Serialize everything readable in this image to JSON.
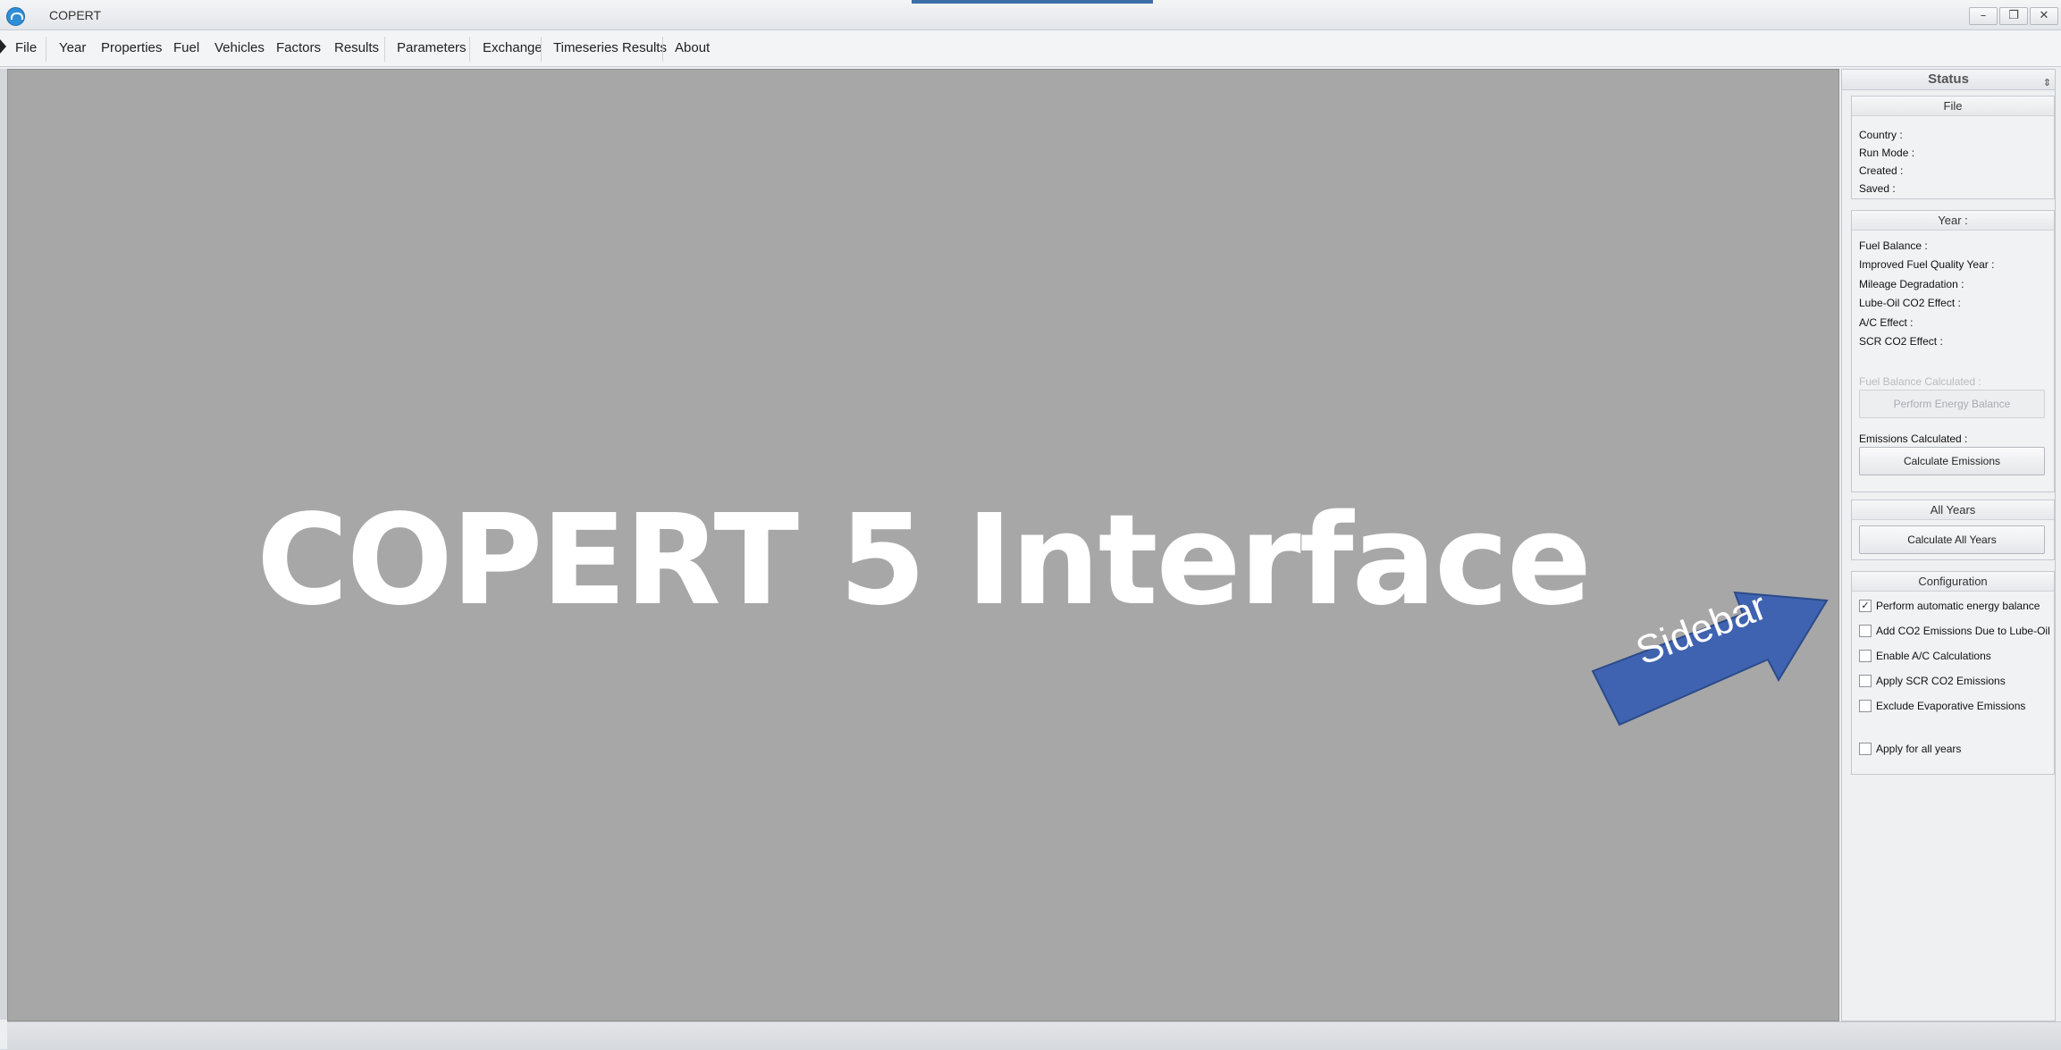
{
  "window": {
    "title": "COPERT",
    "controls": {
      "minimize": "–",
      "restore": "❐",
      "close": "✕"
    }
  },
  "menu": {
    "items": [
      {
        "label": "File"
      },
      {
        "label": "Year"
      },
      {
        "label": "Properties"
      },
      {
        "label": "Fuel"
      },
      {
        "label": "Vehicles"
      },
      {
        "label": "Factors"
      },
      {
        "label": "Results"
      },
      {
        "label": "Parameters"
      },
      {
        "label": "Exchange"
      },
      {
        "label": "Timeseries Results"
      },
      {
        "label": "About"
      }
    ]
  },
  "main": {
    "heading": "COPERT 5 Interface",
    "callout": "Sidebar"
  },
  "sidebar": {
    "title": "Status",
    "pin_icon": "pin-icon",
    "file": {
      "title": "File",
      "country": "Country :",
      "run_mode": "Run Mode :",
      "created": "Created :",
      "saved": "Saved :"
    },
    "year": {
      "title": "Year :",
      "fuel_balance": "Fuel Balance :",
      "improved_fuel_quality_year": "Improved Fuel Quality Year :",
      "mileage_degradation": "Mileage Degradation :",
      "lube_oil_co2_effect": "Lube-Oil CO2 Effect :",
      "ac_effect": "A/C Effect :",
      "scr_co2_effect": "SCR CO2 Effect :",
      "fuel_balance_calculated": "Fuel Balance Calculated :",
      "perform_energy_balance": "Perform Energy Balance",
      "emissions_calculated": "Emissions Calculated :",
      "calculate_emissions": "Calculate Emissions"
    },
    "all_years": {
      "title": "All Years",
      "calculate_all_years": "Calculate All Years"
    },
    "configuration": {
      "title": "Configuration",
      "options": [
        {
          "label": "Perform automatic energy balance",
          "checked": true,
          "mark": "✓"
        },
        {
          "label": "Add CO2 Emissions Due to Lube-Oil",
          "checked": false,
          "mark": ""
        },
        {
          "label": "Enable A/C Calculations",
          "checked": false,
          "mark": ""
        },
        {
          "label": "Apply SCR CO2 Emissions",
          "checked": false,
          "mark": ""
        },
        {
          "label": "Exclude Evaporative Emissions",
          "checked": false,
          "mark": ""
        }
      ],
      "apply_all_years": {
        "label": "Apply for all years",
        "checked": false,
        "mark": ""
      }
    }
  },
  "colors": {
    "canvas": "#a7a7a7",
    "callout_fill": "#3f63b0",
    "callout_stroke": "#2b4a8a"
  }
}
